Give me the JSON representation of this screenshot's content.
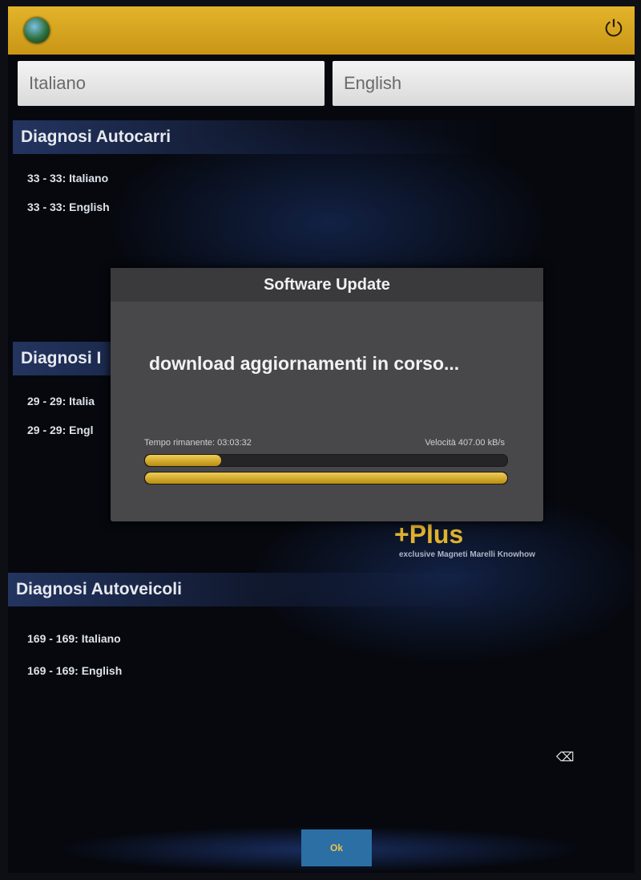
{
  "lang_buttons": {
    "italian": "Italiano",
    "english": "English"
  },
  "sections": [
    {
      "title": "Diagnosi Autocarri",
      "items": [
        "33 - 33: Italiano",
        "33 - 33: English"
      ]
    },
    {
      "title": "Diagnosi I",
      "items": [
        "29 - 29: Italia",
        "29 - 29: Engl"
      ]
    },
    {
      "title": "Diagnosi Autoveicoli",
      "items": [
        "169 - 169: Italiano",
        "169 - 169: English"
      ]
    }
  ],
  "dialog": {
    "title": "Software Update",
    "message": "download aggiornamenti in corso...",
    "time_remaining": "Tempo rimanente: 03:03:32",
    "speed": "Velocità 407.00 kB/s",
    "progress_file": 0.21,
    "progress_total": 1.0
  },
  "branding": {
    "plus": "+Plus",
    "tagline": "exclusive Magneti Marelli Knowhow"
  },
  "ok_button": "Ok",
  "icons": {
    "app": "globe-icon",
    "power": "power-icon",
    "cursor": "cursor-icon"
  },
  "colors": {
    "accent": "#e0b22e",
    "topbar": "#d6a520",
    "dialog": "#48484a",
    "ok": "#2b6fa5"
  }
}
